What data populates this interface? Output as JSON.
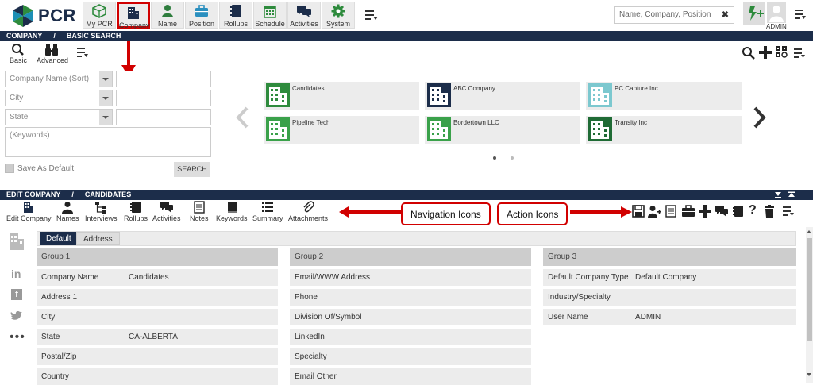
{
  "brand": "PCR",
  "nav": [
    {
      "label": "My PCR",
      "icon": "cube-icon"
    },
    {
      "label": "Company",
      "icon": "building-icon"
    },
    {
      "label": "Name",
      "icon": "person-icon"
    },
    {
      "label": "Position",
      "icon": "briefcase-icon"
    },
    {
      "label": "Rollups",
      "icon": "binder-icon"
    },
    {
      "label": "Schedule",
      "icon": "calendar-icon"
    },
    {
      "label": "Activities",
      "icon": "chat-icon"
    },
    {
      "label": "System",
      "icon": "gear-icon"
    }
  ],
  "search": {
    "placeholder": "Name, Company, Position"
  },
  "user": {
    "name": "ADMIN"
  },
  "basic_search": {
    "header": {
      "section": "COMPANY",
      "sub": "BASIC SEARCH"
    },
    "toolbar": {
      "basic": "Basic",
      "advanced": "Advanced"
    },
    "fields": [
      "Company Name (Sort)",
      "City",
      "State"
    ],
    "keywords_placeholder": "(Keywords)",
    "save_default": "Save As Default",
    "search_button": "SEARCH"
  },
  "cards": [
    "Candidates",
    "ABC Company",
    "PC Capture Inc",
    "Pipeline Tech",
    "Bordertown LLC",
    "Transity Inc"
  ],
  "edit": {
    "header": {
      "section": "EDIT COMPANY",
      "sub": "CANDIDATES"
    },
    "nav_items": [
      "Edit Company",
      "Names",
      "Interviews",
      "Rollups",
      "Activities",
      "Notes",
      "Keywords",
      "Summary",
      "Attachments"
    ],
    "callouts": {
      "nav": "Navigation Icons",
      "action": "Action Icons"
    },
    "tabs": [
      "Default",
      "Address"
    ],
    "groups": [
      {
        "title": "Group 1",
        "rows": [
          {
            "k": "Company Name",
            "v": "Candidates"
          },
          {
            "k": "Address 1",
            "v": ""
          },
          {
            "k": "City",
            "v": ""
          },
          {
            "k": "State",
            "v": "CA-ALBERTA"
          },
          {
            "k": "Postal/Zip",
            "v": ""
          },
          {
            "k": "Country",
            "v": ""
          }
        ]
      },
      {
        "title": "Group 2",
        "rows": [
          {
            "k": "Email/WWW Address",
            "v": ""
          },
          {
            "k": "Phone",
            "v": ""
          },
          {
            "k": "Division Of/Symbol",
            "v": ""
          },
          {
            "k": "LinkedIn",
            "v": ""
          },
          {
            "k": "Specialty",
            "v": ""
          },
          {
            "k": "Email Other",
            "v": ""
          }
        ]
      },
      {
        "title": "Group 3",
        "rows": [
          {
            "k": "Default Company Type",
            "v": "Default Company"
          },
          {
            "k": "Industry/Specialty",
            "v": ""
          },
          {
            "k": "User Name",
            "v": "ADMIN"
          }
        ]
      }
    ]
  },
  "colors": {
    "navy": "#1c2d4a",
    "green": "#2e8b3d",
    "highlight": "#d10000"
  }
}
